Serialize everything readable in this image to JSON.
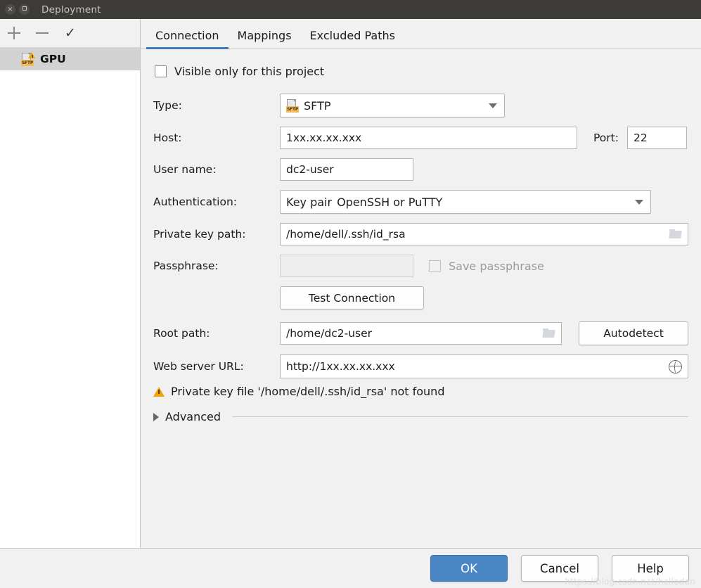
{
  "window": {
    "title": "Deployment",
    "close_icon": "close-icon",
    "maximize_icon": "maximize-icon"
  },
  "sidebar": {
    "toolbar": {
      "add_label": "+",
      "remove_label": "−",
      "check_label": "✓"
    },
    "items": [
      {
        "label": "GPU",
        "icon": "sftp-warning-icon",
        "icon_badge": "SFTP",
        "selected": true
      }
    ]
  },
  "tabs": [
    {
      "label": "Connection",
      "active": true
    },
    {
      "label": "Mappings",
      "active": false
    },
    {
      "label": "Excluded Paths",
      "active": false
    }
  ],
  "form": {
    "visible_only_checkbox": {
      "label": "Visible only for this project",
      "checked": false
    },
    "type": {
      "label": "Type:",
      "value": "SFTP",
      "icon": "sftp-icon",
      "badge": "SFTP"
    },
    "host": {
      "label": "Host:",
      "value": "1xx.xx.xx.xxx"
    },
    "port": {
      "label": "Port:",
      "value": "22"
    },
    "user_name": {
      "label": "User name:",
      "value": "dc2-user"
    },
    "authentication": {
      "label": "Authentication:",
      "value": "Key pair",
      "hint": "OpenSSH or PuTTY"
    },
    "private_key_path": {
      "label": "Private key path:",
      "value": "/home/dell/.ssh/id_rsa",
      "browse_icon": "folder-icon"
    },
    "passphrase": {
      "label": "Passphrase:",
      "value": "",
      "disabled": true
    },
    "save_passphrase": {
      "label": "Save passphrase",
      "checked": false,
      "disabled": true
    },
    "test_connection_button": "Test Connection",
    "root_path": {
      "label": "Root path:",
      "value": "/home/dc2-user",
      "browse_icon": "folder-icon"
    },
    "autodetect_button": "Autodetect",
    "web_server_url": {
      "label": "Web server URL:",
      "value": "http://1xx.xx.xx.xxx",
      "open_icon": "globe-icon"
    },
    "warning": {
      "icon": "warning-triangle-icon",
      "text": "Private key file '/home/dell/.ssh/id_rsa' not found"
    },
    "advanced": {
      "label": "Advanced",
      "expanded": false,
      "icon": "chevron-right-icon"
    }
  },
  "footer": {
    "ok": "OK",
    "cancel": "Cancel",
    "help": "Help",
    "watermark": "https://blog.csdn.net/hellodan"
  },
  "colors": {
    "accent": "#3d7ab8",
    "primary_button": "#4a86c5",
    "warning": "#f0a30a",
    "titlebar": "#3c3b37"
  }
}
